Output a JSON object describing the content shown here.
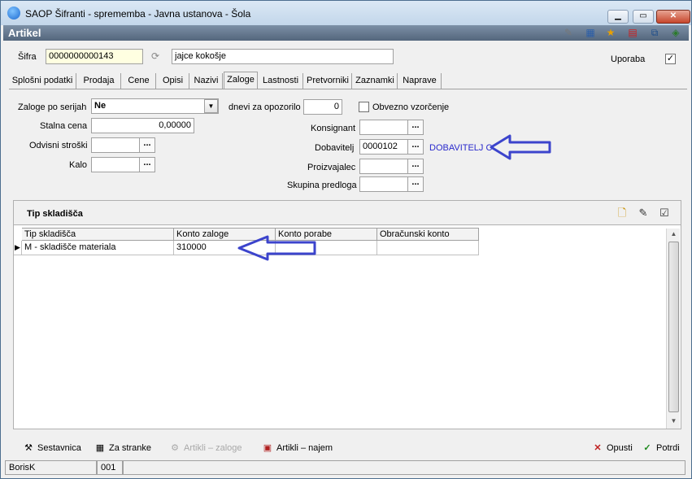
{
  "window": {
    "title": "SAOP Šifranti - sprememba - Javna ustanova - Šola"
  },
  "header": {
    "title": "Artikel"
  },
  "record": {
    "sifra_label": "Šifra",
    "sifra_value": "0000000000143",
    "name_value": "jajce kokošje",
    "uporaba_label": "Uporaba",
    "uporaba_checked": "✓"
  },
  "tabs": [
    {
      "label": "Splošni podatki"
    },
    {
      "label": "Prodaja"
    },
    {
      "label": "Cene"
    },
    {
      "label": "Opisi"
    },
    {
      "label": "Nazivi"
    },
    {
      "label": "Zaloge"
    },
    {
      "label": "Lastnosti"
    },
    {
      "label": "Pretvorniki"
    },
    {
      "label": "Zaznamki"
    },
    {
      "label": "Naprave"
    }
  ],
  "form": {
    "zaloge_po_serijah_label": "Zaloge po serijah",
    "zaloge_po_serijah_value": "Ne",
    "stalna_cena_label": "Stalna cena",
    "stalna_cena_value": "0,00000",
    "odvisni_stroski_label": "Odvisni stroški",
    "kalo_label": "Kalo",
    "dnevi_label": "dnevi za opozorilo",
    "dnevi_value": "0",
    "obvezno_label": "Obvezno vzorčenje",
    "konsignant_label": "Konsignant",
    "dobavitelj_label": "Dobavitelj",
    "dobavitelj_value": "0000102",
    "dobavitelj_name": "DOBAVITELJ C",
    "proizvajalec_label": "Proizvajalec",
    "skupina_label": "Skupina predloga"
  },
  "grid": {
    "title": "Tip skladišča",
    "columns": [
      "Tip skladišča",
      "Konto zaloge",
      "Konto porabe",
      "Obračunski konto"
    ],
    "rows": [
      [
        "M - skladišče materiala",
        "310000",
        "",
        ""
      ]
    ]
  },
  "bottom_buttons": {
    "sestavnica": "Sestavnica",
    "za_stranke": "Za stranke",
    "artikli_zaloge": "Artikli – zaloge",
    "artikli_najem": "Artikli – najem",
    "opusti": "Opusti",
    "potrdi": "Potrdi"
  },
  "status": {
    "user": "BorisK",
    "code": "001"
  },
  "colors": {
    "header_bar": "#54667c",
    "annotation_arrow": "#3c44cc",
    "link": "#2a2acc"
  },
  "icons": [
    "app-icon",
    "minimize-icon",
    "maximize-icon",
    "close-icon",
    "edit-icon",
    "table-icon",
    "star-icon",
    "delete-doc-icon",
    "copy-icon",
    "export-icon",
    "new-record-icon",
    "edit-record-icon",
    "edit-check-icon"
  ]
}
